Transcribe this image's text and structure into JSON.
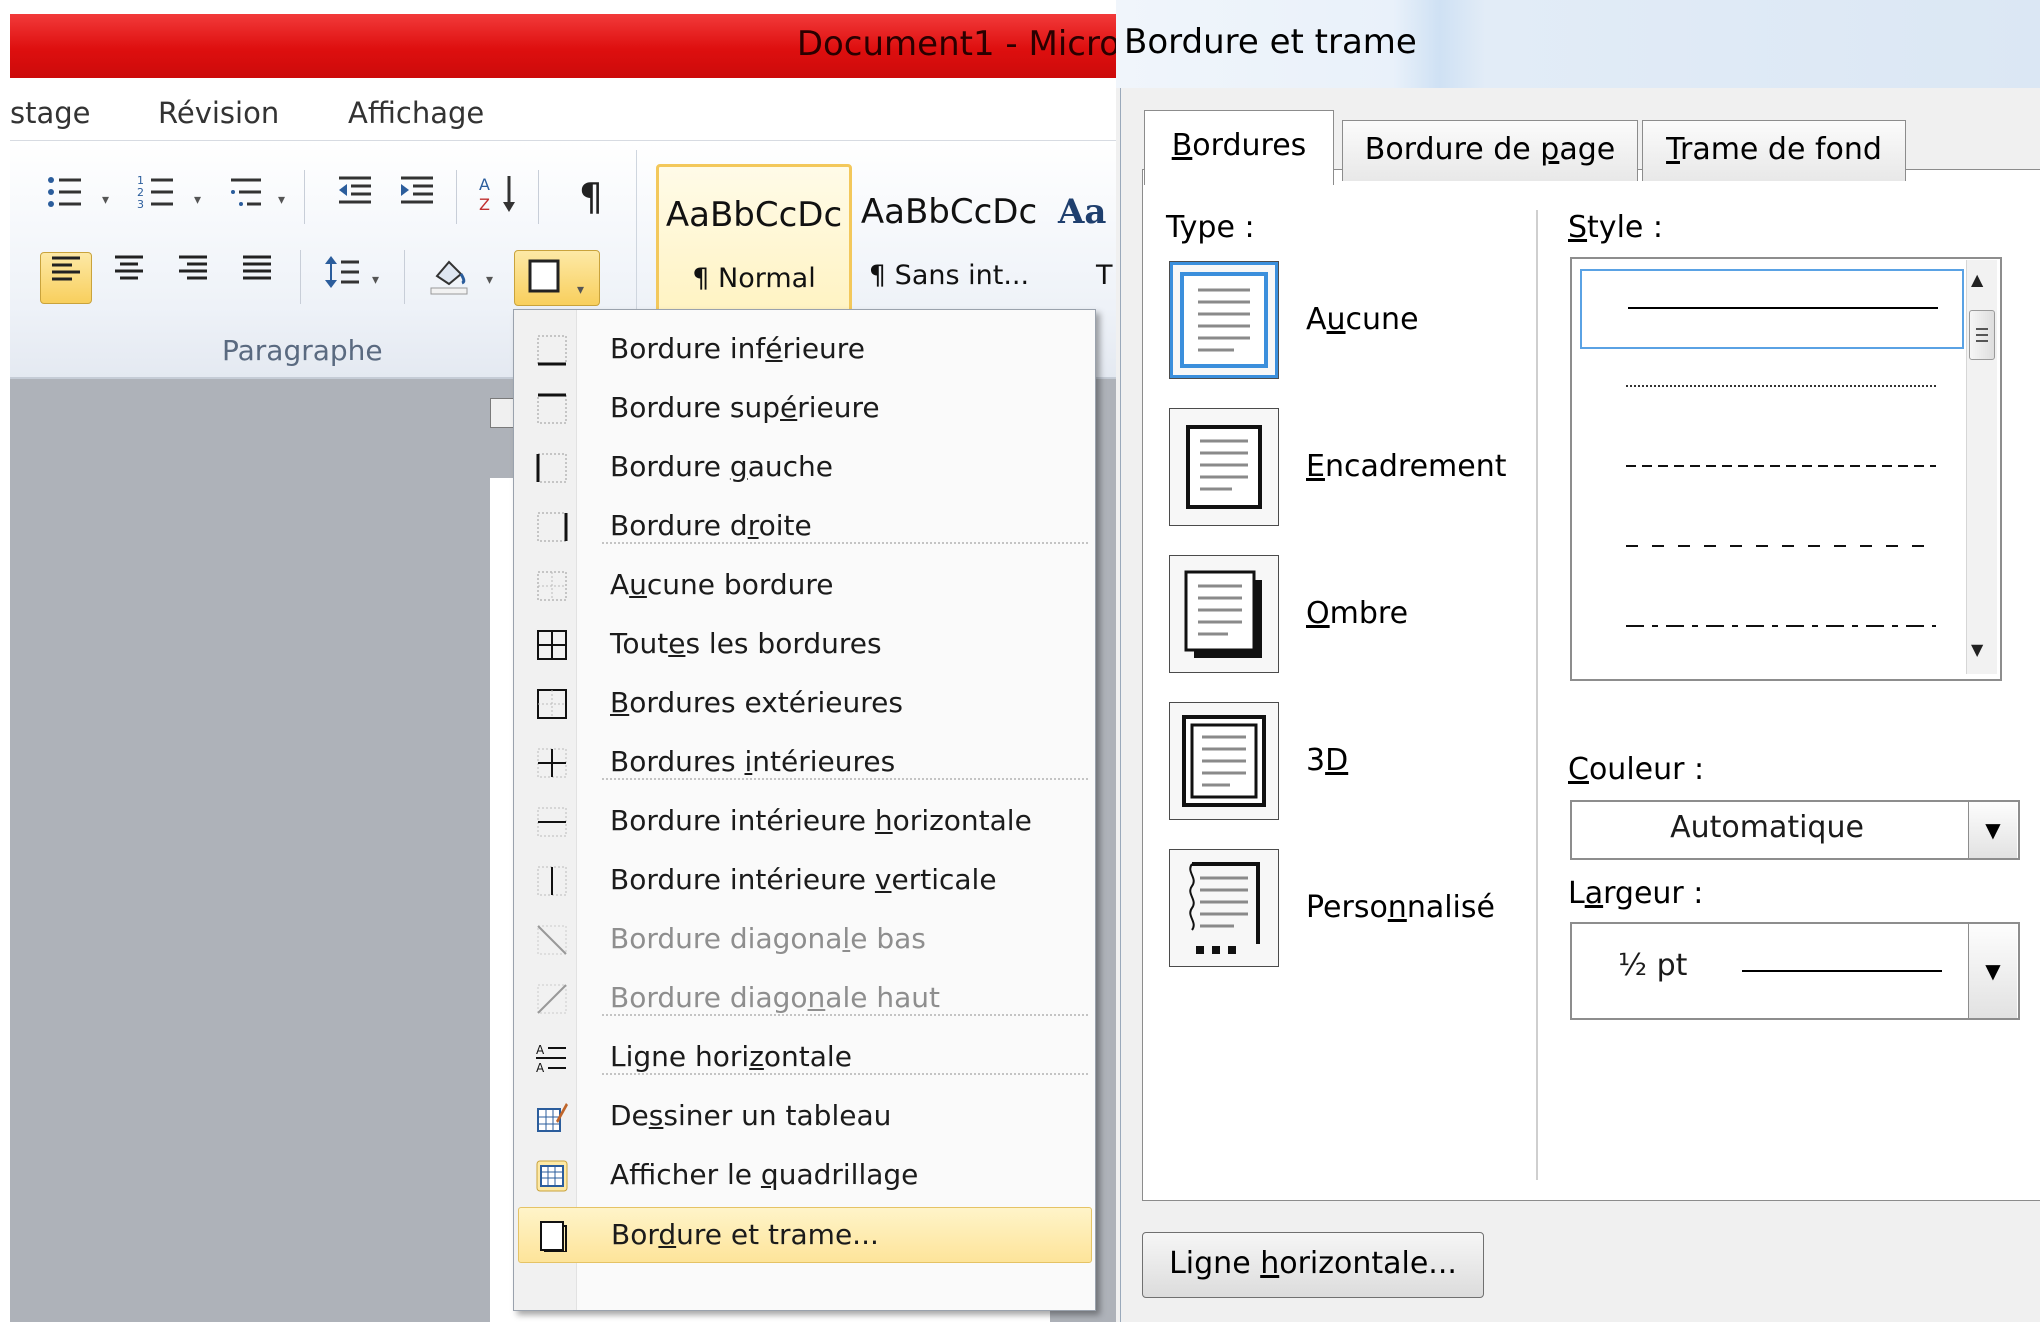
{
  "word": {
    "title": "Document1  -  Micro",
    "ribbon_tabs": [
      "stage",
      "Révision",
      "Affichage"
    ],
    "group_label": "Paragraphe",
    "styles": [
      {
        "sample": "AaBbCcDc",
        "name": "¶ Normal"
      },
      {
        "sample": "AaBbCcDc",
        "name": "¶ Sans int..."
      },
      {
        "sample": "Aa",
        "name": "T"
      }
    ],
    "toolbar_icons": [
      "bullets-icon",
      "numbering-icon",
      "multilevel-list-icon",
      "decrease-indent-icon",
      "increase-indent-icon",
      "sort-icon",
      "pilcrow-icon",
      "align-left-icon",
      "align-center-icon",
      "align-right-icon",
      "justify-icon",
      "line-spacing-icon",
      "shading-icon",
      "borders-icon"
    ]
  },
  "menu": {
    "items": [
      {
        "pre": "Bordure inf",
        "u": "é",
        "post": "rieure",
        "icon": "border-bottom-icon",
        "disabled": false
      },
      {
        "pre": "Bordure sup",
        "u": "é",
        "post": "rieure",
        "icon": "border-top-icon",
        "disabled": false
      },
      {
        "pre": "Bordure ",
        "u": "g",
        "post": "auche",
        "icon": "border-left-icon",
        "disabled": false
      },
      {
        "pre": "Bordure d",
        "u": "r",
        "post": "oite",
        "icon": "border-right-icon",
        "disabled": false
      },
      {
        "pre": "A",
        "u": "u",
        "post": "cune bordure",
        "icon": "no-border-icon",
        "disabled": false
      },
      {
        "pre": "Tout",
        "u": "e",
        "post": "s les bordures",
        "icon": "all-borders-icon",
        "disabled": false
      },
      {
        "pre": "",
        "u": "B",
        "post": "ordures extérieures",
        "icon": "outside-borders-icon",
        "disabled": false
      },
      {
        "pre": "Bordures ",
        "u": "i",
        "post": "ntérieures",
        "icon": "inside-borders-icon",
        "disabled": false
      },
      {
        "pre": "Bordure intérieure ",
        "u": "h",
        "post": "orizontale",
        "icon": "inside-horizontal-border-icon",
        "disabled": false
      },
      {
        "pre": "Bordure intérieure ",
        "u": "v",
        "post": "erticale",
        "icon": "inside-vertical-border-icon",
        "disabled": false
      },
      {
        "pre": "Bordure diagona",
        "u": "l",
        "post": "e bas",
        "icon": "diagonal-down-border-icon",
        "disabled": true
      },
      {
        "pre": "Bordure diago",
        "u": "n",
        "post": "ale haut",
        "icon": "diagonal-up-border-icon",
        "disabled": true
      },
      {
        "pre": "Ligne hori",
        "u": "z",
        "post": "ontale",
        "icon": "horizontal-line-icon",
        "disabled": false
      },
      {
        "pre": "De",
        "u": "s",
        "post": "siner un tableau",
        "icon": "draw-table-icon",
        "disabled": false
      },
      {
        "pre": "Afficher le ",
        "u": "q",
        "post": "uadrillage",
        "icon": "view-gridlines-icon",
        "disabled": false
      },
      {
        "pre": "Bor",
        "u": "d",
        "post": "ure et trame...",
        "icon": "borders-shading-icon",
        "disabled": false
      }
    ]
  },
  "dialog": {
    "title": "Bordure et trame",
    "tabs": [
      {
        "u": "B",
        "post": "ordures"
      },
      {
        "pre": "Bordure de ",
        "u": "p",
        "post": "age"
      },
      {
        "u": "T",
        "post": "rame de fond"
      }
    ],
    "type_label": "Type :",
    "types": [
      {
        "pre": "A",
        "u": "u",
        "post": "cune"
      },
      {
        "pre": "",
        "u": "E",
        "post": "ncadrement"
      },
      {
        "pre": "",
        "u": "O",
        "post": "mbre"
      },
      {
        "pre": "3",
        "u": "D",
        "post": ""
      },
      {
        "pre": "Perso",
        "u": "n",
        "post": "nalisé"
      }
    ],
    "style_label": {
      "u": "S",
      "post": "tyle :"
    },
    "color_label": {
      "u": "C",
      "post": "ouleur :"
    },
    "color_value": "Automatique",
    "width_label": {
      "pre": "L",
      "u": "a",
      "post": "rgeur :"
    },
    "width_value": "½ pt",
    "hline_button": {
      "pre": "Ligne ",
      "u": "h",
      "post": "orizontale..."
    },
    "accent_color": "#3b8fdc"
  }
}
